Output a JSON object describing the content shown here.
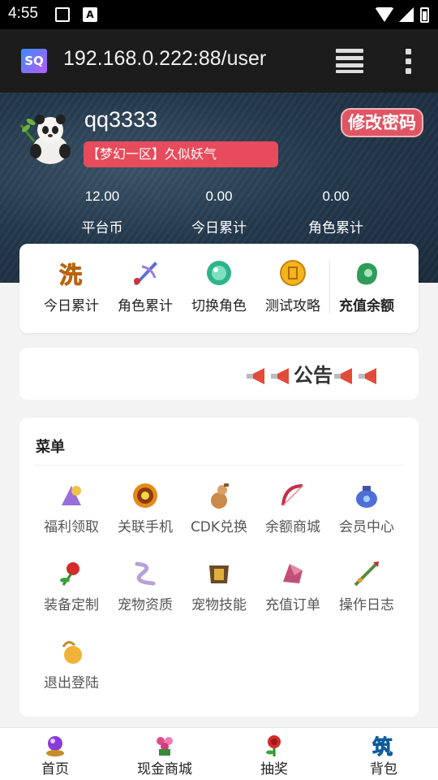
{
  "status_bar": {
    "time": "4:55"
  },
  "app_bar": {
    "logo_text": "SQ",
    "url": "192.168.0.222:88/user"
  },
  "user": {
    "name": "qq3333",
    "server_badge": "【梦幻一区】久似妖气",
    "change_password_label": "修改密码"
  },
  "stats": [
    {
      "value": "12.00",
      "label": "平台币"
    },
    {
      "value": "0.00",
      "label": "今日累计"
    },
    {
      "value": "0.00",
      "label": "角色累计"
    }
  ],
  "quick_actions": [
    {
      "label": "今日累计",
      "icon": "wash-icon"
    },
    {
      "label": "角色累计",
      "icon": "sword-icon"
    },
    {
      "label": "切换角色",
      "icon": "orb-icon"
    },
    {
      "label": "测试攻略",
      "icon": "coin-icon"
    },
    {
      "label": "充值余额",
      "icon": "jade-icon"
    }
  ],
  "notice": {
    "label": "公告"
  },
  "menu": {
    "title": "菜单",
    "items": [
      {
        "label": "福利领取",
        "icon": "gift-icon"
      },
      {
        "label": "关联手机",
        "icon": "wheel-icon"
      },
      {
        "label": "CDK兑换",
        "icon": "gourd-icon"
      },
      {
        "label": "余额商城",
        "icon": "bow-icon"
      },
      {
        "label": "会员中心",
        "icon": "bag-icon"
      },
      {
        "label": "装备定制",
        "icon": "flower-icon"
      },
      {
        "label": "宠物资质",
        "icon": "scarf-icon"
      },
      {
        "label": "宠物技能",
        "icon": "armor-icon"
      },
      {
        "label": "充值订单",
        "icon": "crystal-icon"
      },
      {
        "label": "操作日志",
        "icon": "spear-icon"
      },
      {
        "label": "退出登陆",
        "icon": "purse-icon"
      }
    ]
  },
  "bottom_nav": [
    {
      "label": "首页",
      "icon": "home-orb-icon"
    },
    {
      "label": "现金商城",
      "icon": "shop-icon"
    },
    {
      "label": "抽奖",
      "icon": "lottery-icon"
    },
    {
      "label": "背包",
      "icon": "backpack-icon"
    }
  ]
}
